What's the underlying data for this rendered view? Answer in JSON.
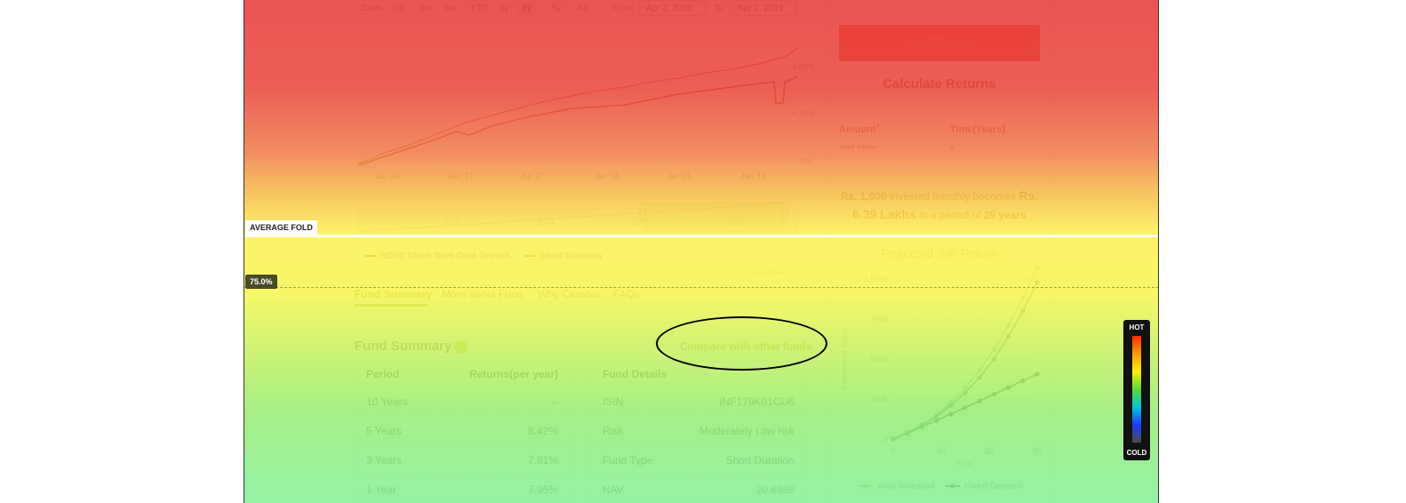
{
  "zoom": {
    "label": "Zoom",
    "buttons": [
      "1m",
      "3m",
      "6m",
      "YTD",
      "1y",
      "3y",
      "5y",
      "All"
    ],
    "selected": "3y",
    "from_label": "From",
    "from_value": "Apr 2, 2016",
    "to_label": "To",
    "to_value": "Apr 2, 2019"
  },
  "nav_chart": {
    "y_ticks": [
      "+ 20%",
      "+ 10%",
      "0%"
    ],
    "x_ticks": [
      "Jul '16",
      "Jan '17",
      "Jul '17",
      "Jan '18",
      "Jul '18",
      "Jan '19"
    ],
    "navigator_years": [
      "2013",
      "2014",
      "2016",
      "2018"
    ],
    "legend": [
      "HDFC Short Term Debt Growth",
      "Short Duration"
    ],
    "credit": "Highcharts.com"
  },
  "tabs": [
    "Fund Summary",
    "More about Fund",
    "Why Cleartax",
    "FAQs"
  ],
  "fund_summary": {
    "title": "Fund Summary",
    "compare_link": "Compare with other funds",
    "returns_table": {
      "headers": [
        "Period",
        "Returns(per year)"
      ],
      "rows": [
        [
          "10 Years",
          "--"
        ],
        [
          "5 Years",
          "8.42%"
        ],
        [
          "3 Years",
          "7.81%"
        ],
        [
          "1 Year",
          "7.95%"
        ]
      ]
    },
    "details_table": {
      "header": "Fund Details",
      "rows": [
        [
          "ISIN",
          "INF179K01CU6"
        ],
        [
          "Risk",
          "Moderately Low risk"
        ],
        [
          "Fund Type",
          "Short Duration"
        ],
        [
          "NAV",
          "20.6986"
        ]
      ]
    }
  },
  "sidebar": {
    "invest_button": "INVEST NOW",
    "calc_title": "Calculate Returns",
    "amount_label": "Amount",
    "amount_value": "**** *****",
    "time_label": "Time(Years)",
    "time_value": "*",
    "result_prefix": "Rs. 1,000",
    "result_mid": " invested monthly becomes ",
    "result_amount": "Rs. 6.39 Lakhs",
    "result_mid2": " in a period of ",
    "result_years": "25 years",
    "sip_title": "Projected SIP Return",
    "y_axis_title": "Investment Value",
    "x_axis_title": "Year",
    "legend": [
      "Your Invested",
      "Fixed Deposit"
    ]
  },
  "chart_data": {
    "type": "line",
    "title": "Projected SIP Return",
    "xlabel": "Year",
    "ylabel": "Investment Value",
    "x": [
      0,
      3,
      6,
      9,
      12,
      15,
      18,
      21,
      24,
      27,
      30
    ],
    "y_tick_labels": [
      "0",
      "250k",
      "500k",
      "750k",
      "1,000k"
    ],
    "x_tick_labels": [
      "0",
      "10",
      "20",
      "30"
    ],
    "xlim": [
      0,
      30
    ],
    "ylim": [
      0,
      1000000
    ],
    "series": [
      {
        "name": "Your Invested",
        "color": "#9fd9b0",
        "values": [
          0,
          40000,
          90000,
          150000,
          230000,
          320000,
          430000,
          560000,
          710000,
          880000,
          1070000
        ]
      },
      {
        "name": "Fixed Deposit",
        "color": "#555555",
        "values": [
          0,
          36000,
          76000,
          115000,
          156000,
          197000,
          238000,
          280000,
          322000,
          364000,
          406000
        ]
      },
      {
        "name": "",
        "color": "#6b8e5a",
        "values": [
          0,
          38000,
          85000,
          140000,
          210000,
          290000,
          385000,
          500000,
          640000,
          800000,
          980000
        ]
      }
    ],
    "legend_position": "bottom"
  },
  "overlay": {
    "average_fold_label": "AVERAGE FOLD",
    "percent_label": "75.0%",
    "legend_hot": "HOT",
    "legend_cold": "COLD",
    "colors": {
      "hot": "#e83c3c",
      "warm": "#f7ef4f",
      "cool": "#86ef8f",
      "fold_line": "#ffffff",
      "ellipse": "#000000"
    }
  }
}
